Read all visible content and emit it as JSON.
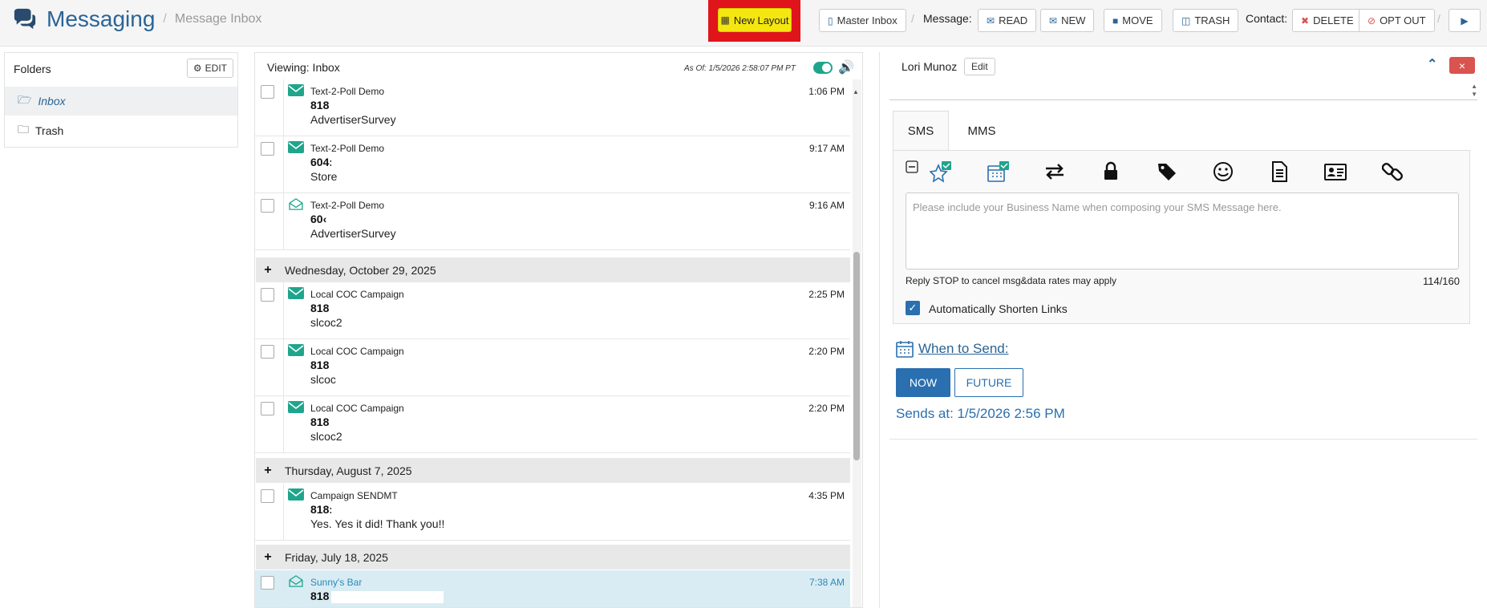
{
  "header": {
    "title": "Messaging",
    "breadcrumb_sep": "/",
    "subtitle": "Message Inbox",
    "new_layout": "New Layout",
    "master_inbox": "Master Inbox",
    "message_label": "Message:",
    "read": "READ",
    "new": "NEW",
    "move": "MOVE",
    "trash": "TRASH",
    "contact_label": "Contact:",
    "delete": "DELETE",
    "opt_out": "OPT OUT",
    "sep": "/"
  },
  "folders": {
    "title": "Folders",
    "edit": "EDIT",
    "items": [
      {
        "label": "Inbox"
      },
      {
        "label": "Trash"
      }
    ]
  },
  "list": {
    "viewing": "Viewing: Inbox",
    "as_of": "As Of: 1/5/2026 2:58:07 PM PT",
    "rows": [
      {
        "sender": "Text-2-Poll Demo",
        "phone": "818",
        "body": "AdvertiserSurvey",
        "time": "1:06 PM"
      },
      {
        "sender": "Text-2-Poll Demo",
        "phone": "604:",
        "body": "Store",
        "time": "9:17 AM"
      },
      {
        "sender": "Text-2-Poll Demo",
        "phone": "60‹",
        "body": "AdvertiserSurvey",
        "time": "9:16 AM"
      },
      {
        "sender": "Local COC Campaign",
        "phone": "818",
        "body": "slcoc2",
        "time": "2:25 PM"
      },
      {
        "sender": "Local COC Campaign",
        "phone": "818",
        "body": "slcoc",
        "time": "2:20 PM"
      },
      {
        "sender": "Local COC Campaign",
        "phone": "818",
        "body": "slcoc2",
        "time": "2:20 PM"
      },
      {
        "sender": "Campaign SENDMT",
        "phone": "818:",
        "body": "Yes. Yes it did! Thank you!!",
        "time": "4:35 PM"
      },
      {
        "sender": "Sunny's Bar",
        "phone": "818",
        "body": "",
        "time": "7:38 AM"
      }
    ],
    "days": [
      {
        "label": "Wednesday, October 29, 2025"
      },
      {
        "label": "Thursday, August 7, 2025"
      },
      {
        "label": "Friday, July 18, 2025"
      }
    ]
  },
  "contact": {
    "name": "Lori Munoz",
    "edit": "Edit",
    "close": "×"
  },
  "composer": {
    "tab_sms": "SMS",
    "tab_mms": "MMS",
    "placeholder": "Please include your Business Name when composing your SMS Message here.",
    "reply_stop": "Reply STOP to cancel msg&data rates may apply",
    "counter": "114/160",
    "auto_shorten": "Automatically Shorten Links",
    "auto_shorten_checked": true,
    "toolbar_icons": [
      "collapse-icon",
      "star-check-icon",
      "calendar-check-icon",
      "swap-icon",
      "lock-icon",
      "tag-icon",
      "smiley-icon",
      "document-icon",
      "contact-card-icon",
      "link-icon"
    ]
  },
  "schedule": {
    "when_to_send": "When to Send:",
    "now": "NOW",
    "future": "FUTURE",
    "sends_at": "Sends at: 1/5/2026 2:56 PM"
  },
  "colors": {
    "brand": "#2a6496",
    "accent": "#2a6fb0",
    "teal": "#1fa58c",
    "highlight_red": "#e0141b",
    "highlight_yellow": "#f4e60f",
    "danger": "#d9534f",
    "selected_row": "#d9ecf3"
  }
}
